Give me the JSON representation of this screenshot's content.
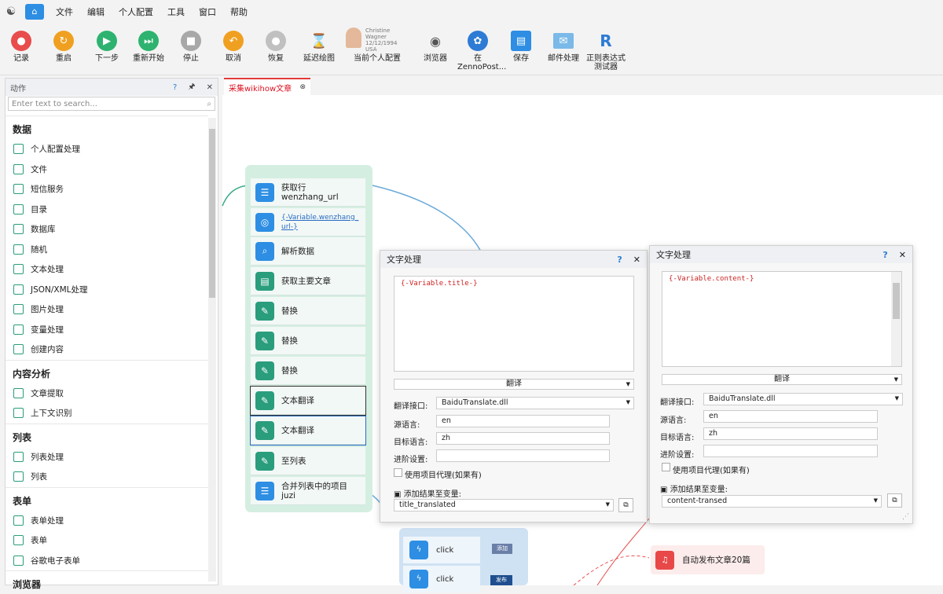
{
  "menu": {
    "items": [
      "文件",
      "编辑",
      "个人配置",
      "工具",
      "窗口",
      "帮助"
    ]
  },
  "toolbar": {
    "buttons": [
      {
        "label": "记录",
        "color": "#e84c4c"
      },
      {
        "label": "重启",
        "color": "#f0a020"
      },
      {
        "label": "下一步",
        "color": "#2db36f"
      },
      {
        "label": "重新开始",
        "color": "#2db36f"
      },
      {
        "label": "停止",
        "color": "#a8a8a8"
      },
      {
        "label": "取消",
        "color": "#f0a020"
      },
      {
        "label": "恢复",
        "color": "#c0c0c0"
      },
      {
        "label": "延迟绘图"
      },
      {
        "label": "当前个人配置"
      },
      {
        "label": "浏览器"
      },
      {
        "label": "在",
        "label2": "ZennoPost..."
      },
      {
        "label": "保存"
      },
      {
        "label": "邮件处理"
      },
      {
        "label": "正则表达式",
        "label2": "测试器"
      }
    ],
    "profile": {
      "name": "Christine Wagner",
      "dob": "12/12/1994",
      "country": "USA"
    }
  },
  "sidebar": {
    "title": "动作",
    "help": "?",
    "pin": "🖈",
    "close": "✕",
    "search_placeholder": "Enter text to search...",
    "categories": [
      {
        "name": "数据",
        "items": [
          "个人配置处理",
          "文件",
          "短信服务",
          "目录",
          "数据库",
          "随机",
          "文本处理",
          "JSON/XML处理",
          "图片处理",
          "变量处理",
          "创建内容"
        ]
      },
      {
        "name": "内容分析",
        "items": [
          "文章提取",
          "上下文识别"
        ]
      },
      {
        "name": "列表",
        "items": [
          "列表处理",
          "列表"
        ]
      },
      {
        "name": "表单",
        "items": [
          "表单处理",
          "表单",
          "谷歌电子表单"
        ]
      },
      {
        "name": "浏览器",
        "items": []
      }
    ]
  },
  "tab": {
    "label": "采集wikihow文章",
    "close": "⊗"
  },
  "blocks": [
    "获取行 wenzhang_url",
    "{-Variable.wenzhang_url-}",
    "解析数据",
    "获取主要文章",
    "替换",
    "替换",
    "替换",
    "文本翻译",
    "文本翻译",
    "至列表",
    "合并列表中的项目 juzi"
  ],
  "dialog1": {
    "title": "文字处理",
    "help": "?",
    "close": "✕",
    "text": "{-Variable.title-}",
    "mode": "翻译",
    "api_label": "翻译接口:",
    "api_value": "BaiduTranslate.dll",
    "src_label": "源语言:",
    "src_value": "en",
    "tgt_label": "目标语言:",
    "tgt_value": "zh",
    "adv_label": "进阶设置:",
    "proxy_label": "使用项目代理(如果有)",
    "save_label": "添加结果至变量:",
    "save_value": "title_translated"
  },
  "dialog2": {
    "title": "文字处理",
    "help": "?",
    "close": "✕",
    "text": "{-Variable.content-}",
    "mode": "翻译",
    "api_label": "翻译接口:",
    "api_value": "BaiduTranslate.dll",
    "src_label": "源语言:",
    "src_value": "en",
    "tgt_label": "目标语言:",
    "tgt_value": "zh",
    "adv_label": "进阶设置:",
    "proxy_label": "使用项目代理(如果有)",
    "save_label": "添加结果至变量:",
    "save_value": "content-transed"
  },
  "clicks": [
    {
      "label": "click",
      "tag": "添加"
    },
    {
      "label": "click",
      "tag": "发布"
    }
  ],
  "notif": {
    "label": "自动发布文章20篇"
  }
}
